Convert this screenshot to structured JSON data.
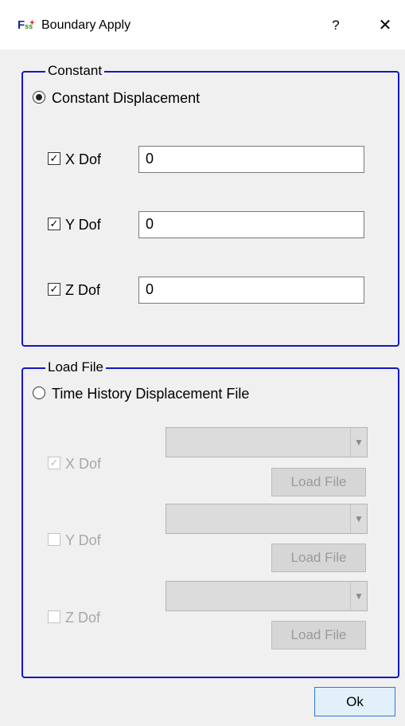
{
  "window": {
    "title": "Boundary Apply",
    "help_label": "?",
    "close_label": "✕"
  },
  "constant_group": {
    "title": "Constant",
    "radio_label": "Constant Displacement",
    "radio_checked": true,
    "rows": [
      {
        "label": "X Dof",
        "checked": true,
        "value": "0"
      },
      {
        "label": "Y Dof",
        "checked": true,
        "value": "0"
      },
      {
        "label": "Z Dof",
        "checked": true,
        "value": "0"
      }
    ]
  },
  "load_group": {
    "title": "Load File",
    "radio_label": "Time History Displacement File",
    "radio_checked": false,
    "rows": [
      {
        "label": "X Dof",
        "checked": true,
        "button": "Load File"
      },
      {
        "label": "Y Dof",
        "checked": false,
        "button": "Load File"
      },
      {
        "label": "Z Dof",
        "checked": false,
        "button": "Load File"
      }
    ]
  },
  "footer": {
    "ok_label": "Ok"
  },
  "colors": {
    "group_border": "#1515c8",
    "ok_border": "#2b7ad6",
    "ok_fill": "#e1f0fb"
  }
}
